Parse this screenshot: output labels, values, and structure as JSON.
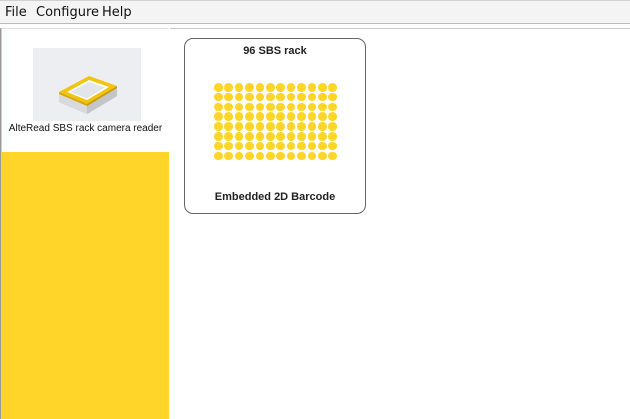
{
  "menu": {
    "items": [
      "File",
      "Configure",
      "Help"
    ]
  },
  "sidebar": {
    "device": {
      "label": "AlteRead SBS rack camera reader",
      "icon": "camera-reader-device-image"
    },
    "accent_color": "#ffd52a"
  },
  "main": {
    "rack_card": {
      "title": "96 SBS rack",
      "footer": "Embedded 2D Barcode",
      "wells": {
        "rows": 8,
        "columns": 12,
        "color": "#ffd52a"
      }
    }
  }
}
